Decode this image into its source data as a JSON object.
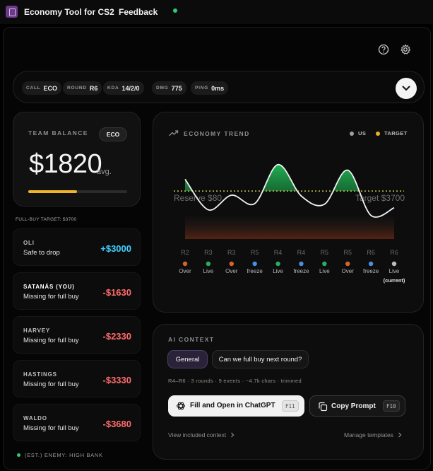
{
  "window": {
    "title": "Economy Tool for CS2",
    "menu_feedback": "Feedback"
  },
  "infobar": {
    "chips": [
      {
        "key": "CALL",
        "value": "ECO"
      },
      {
        "key": "ROUND",
        "value": "R6"
      },
      {
        "key": "KDA",
        "value": "14/2/0"
      },
      {
        "key": "DMG",
        "value": "775"
      },
      {
        "key": "PING",
        "value": "0ms"
      }
    ]
  },
  "balance": {
    "label": "TEAM BALANCE",
    "badge": "ECO",
    "amount": "$1820",
    "unit": "avg.",
    "progress": 0.49
  },
  "target_note": "FULL-BUY TARGET: $3700",
  "players": [
    {
      "name": "OLI",
      "status": "Safe to drop",
      "amount": "+$3000",
      "positive": true
    },
    {
      "name": "SATANÁS (YOU)",
      "status": "Missing for full buy",
      "amount": "-$1630",
      "positive": false
    },
    {
      "name": "HARVEY",
      "status": "Missing for full buy",
      "amount": "-$2330",
      "positive": false
    },
    {
      "name": "HASTINGS",
      "status": "Missing for full buy",
      "amount": "-$3330",
      "positive": false
    },
    {
      "name": "WALDO",
      "status": "Missing for full buy",
      "amount": "-$3680",
      "positive": false
    }
  ],
  "enemy": "(EST.) ENEMY: HIGH BANK",
  "chart_data": {
    "type": "line",
    "title": "ECONOMY TREND",
    "legend": [
      {
        "name": "US",
        "color": "#a0a0a0"
      },
      {
        "name": "TARGET",
        "color": "#e6b422"
      }
    ],
    "categories": [
      "R2",
      "R3",
      "R3",
      "R5",
      "R4",
      "R4",
      "R5",
      "R5",
      "R6",
      "R6"
    ],
    "round_outcomes": [
      "Over",
      "Live",
      "Over",
      "freeze",
      "Live",
      "freeze",
      "Live",
      "Over",
      "freeze",
      "Live"
    ],
    "outcome_colors": [
      "#d9622b",
      "#27ae60",
      "#d9622b",
      "#4a8fe0",
      "#27ae60",
      "#4a8fe0",
      "#27ae60",
      "#d9622b",
      "#4a8fe0",
      "#bdbdbd"
    ],
    "current_label": "(current)",
    "series": [
      {
        "name": "US",
        "values": [
          5400,
          1000,
          3100,
          1900,
          7500,
          3000,
          1800,
          6700,
          200,
          1300
        ]
      }
    ],
    "target": 3700,
    "reserve": 80,
    "reserve_label": "Reserve $80",
    "target_label": "Target $3700",
    "ylim": [
      -3200,
      9000
    ]
  },
  "ai": {
    "title": "AI CONTEXT",
    "tabs": [
      "General",
      "Can we full buy next round?"
    ],
    "meta": "R4–R6 · 3 rounds · 9 events · ~4.7k chars · trimmed",
    "fill_button": "Fill and Open in ChatGPT",
    "fill_key": "F11",
    "copy_button": "Copy Prompt",
    "copy_key": "F10",
    "view_link": "View included context",
    "manage_link": "Manage templates"
  },
  "colors": {
    "accent": "#f0b429",
    "positive": "#3fd0ff",
    "negative": "#ff6b6b",
    "live": "#2ecc71"
  }
}
